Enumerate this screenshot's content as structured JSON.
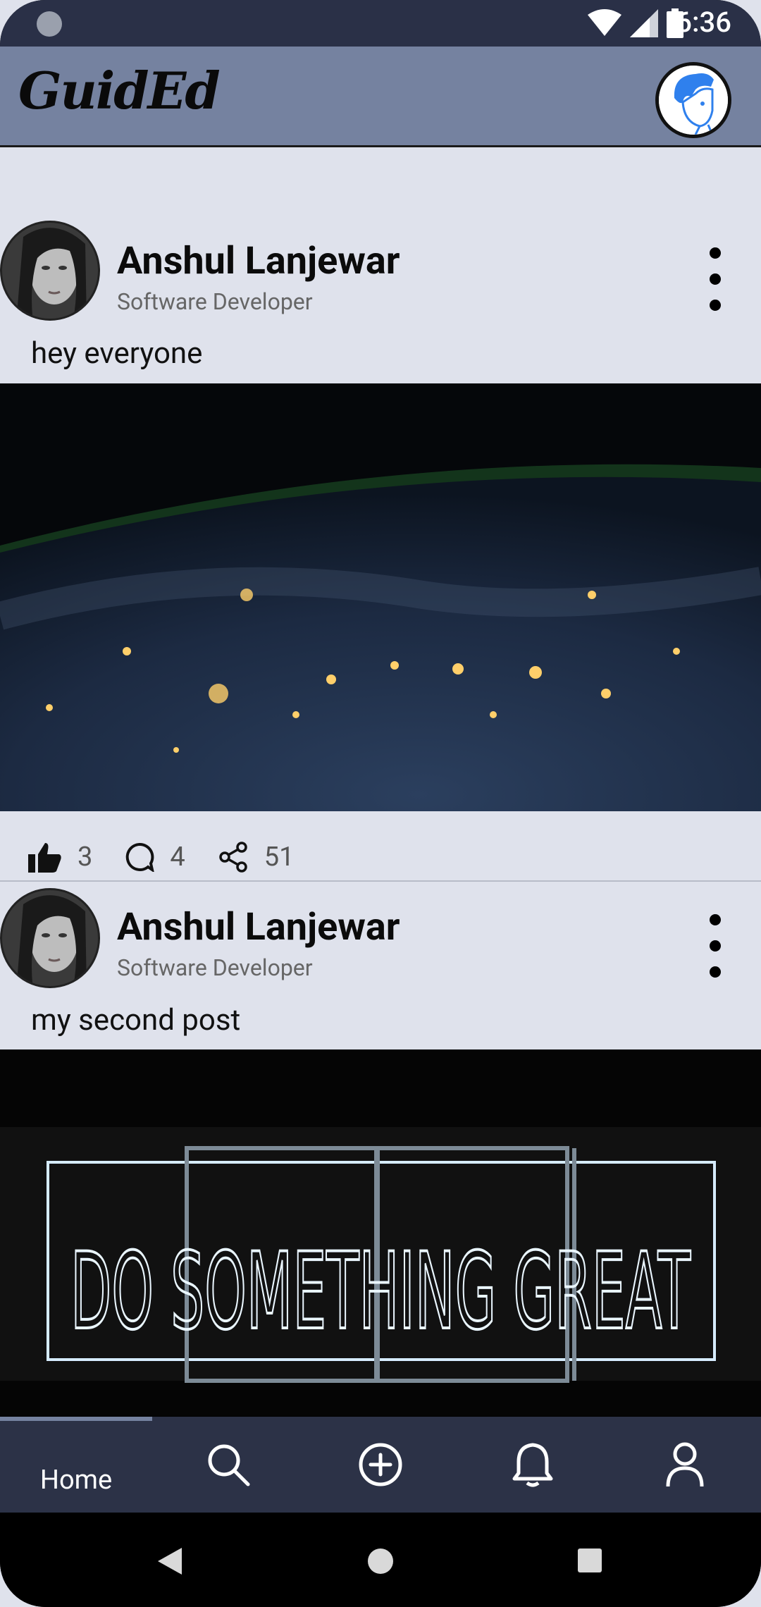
{
  "status_bar": {
    "time": "6:36"
  },
  "app_bar": {
    "logo_text": "GuidEd"
  },
  "posts": [
    {
      "author": "Anshul Lanjewar",
      "subtitle": "Software Developer",
      "text": "hey everyone",
      "likes": "3",
      "comments": "4",
      "shares": "51"
    },
    {
      "author": "Anshul Lanjewar",
      "subtitle": "Software Developer",
      "text": "my second post",
      "image_caption": "DO SOMETHING GREAT"
    }
  ],
  "bottom_nav": {
    "home_label": "Home"
  },
  "colors": {
    "status_bar": "#2a3047",
    "app_bar": "#7582a0",
    "feed_bg": "#dfe2ec",
    "bottom_nav": "#2c3247",
    "accent_blue": "#2f80ed"
  }
}
